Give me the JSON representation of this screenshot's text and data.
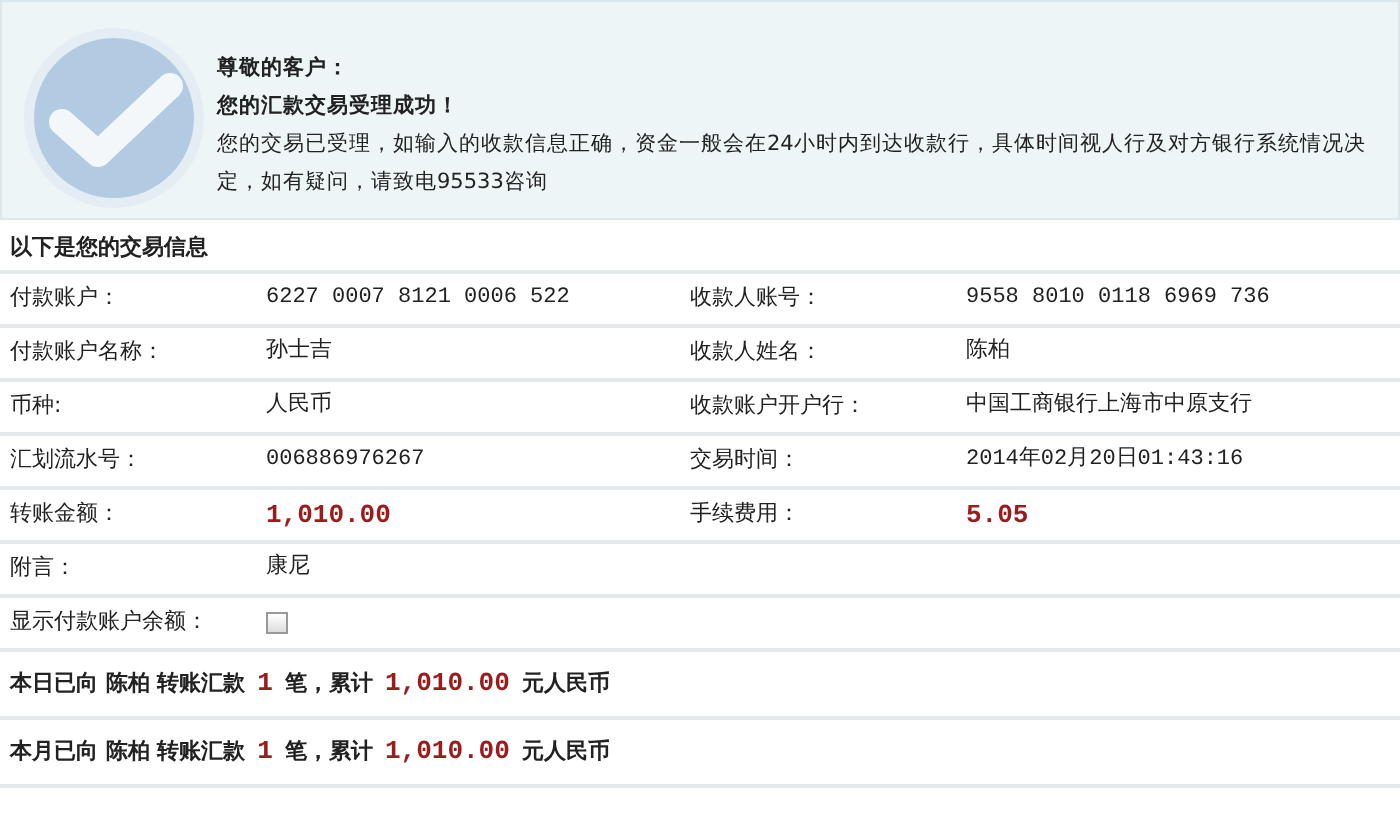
{
  "notice": {
    "greeting": "尊敬的客户：",
    "headline": "您的汇款交易受理成功！",
    "message": "您的交易已受理，如输入的收款信息正确，资金一般会在24小时内到达收款行，具体时间视人行及对方银行系统情况决定，如有疑问，请致电95533咨询"
  },
  "details": {
    "title": "以下是您的交易信息",
    "rows": [
      {
        "kind": "pair",
        "cells": [
          {
            "label": "付款账户：",
            "value": "6227 0007 8121 0006 522",
            "emphasis": false
          },
          {
            "label": "收款人账号：",
            "value": "9558 8010 0118 6969 736",
            "emphasis": false
          }
        ]
      },
      {
        "kind": "pair",
        "cells": [
          {
            "label": "付款账户名称：",
            "value": "孙士吉",
            "emphasis": false
          },
          {
            "label": "收款人姓名：",
            "value": "陈柏",
            "emphasis": false
          }
        ]
      },
      {
        "kind": "pair",
        "cells": [
          {
            "label": "币种:",
            "value": "人民币",
            "emphasis": false
          },
          {
            "label": "收款账户开户行：",
            "value": "中国工商银行上海市中原支行",
            "emphasis": false
          }
        ]
      },
      {
        "kind": "pair",
        "cells": [
          {
            "label": "汇划流水号：",
            "value": "006886976267",
            "emphasis": false
          },
          {
            "label": "交易时间：",
            "value": "2014年02月20日01:43:16",
            "emphasis": false
          }
        ]
      },
      {
        "kind": "pair",
        "cells": [
          {
            "label": "转账金额：",
            "value": "1,010.00",
            "emphasis": true
          },
          {
            "label": "手续费用：",
            "value": "5.05",
            "emphasis": true
          }
        ]
      },
      {
        "kind": "pair",
        "cells": [
          {
            "label": "附言：",
            "value": "康尼",
            "emphasis": false
          }
        ]
      },
      {
        "kind": "checkbox",
        "label": "显示付款账户余额：",
        "checked": false
      }
    ]
  },
  "summaries": [
    [
      {
        "text": "本日已向 陈柏 转账汇款",
        "emphasis": false
      },
      {
        "text": "1",
        "emphasis": true
      },
      {
        "text": "笔，累计",
        "emphasis": false
      },
      {
        "text": "1,010.00",
        "emphasis": true
      },
      {
        "text": "元人民币",
        "emphasis": false
      }
    ],
    [
      {
        "text": "本月已向 陈柏 转账汇款",
        "emphasis": false
      },
      {
        "text": "1",
        "emphasis": true
      },
      {
        "text": "笔，累计",
        "emphasis": false
      },
      {
        "text": "1,010.00",
        "emphasis": true
      },
      {
        "text": "元人民币",
        "emphasis": false
      }
    ]
  ]
}
